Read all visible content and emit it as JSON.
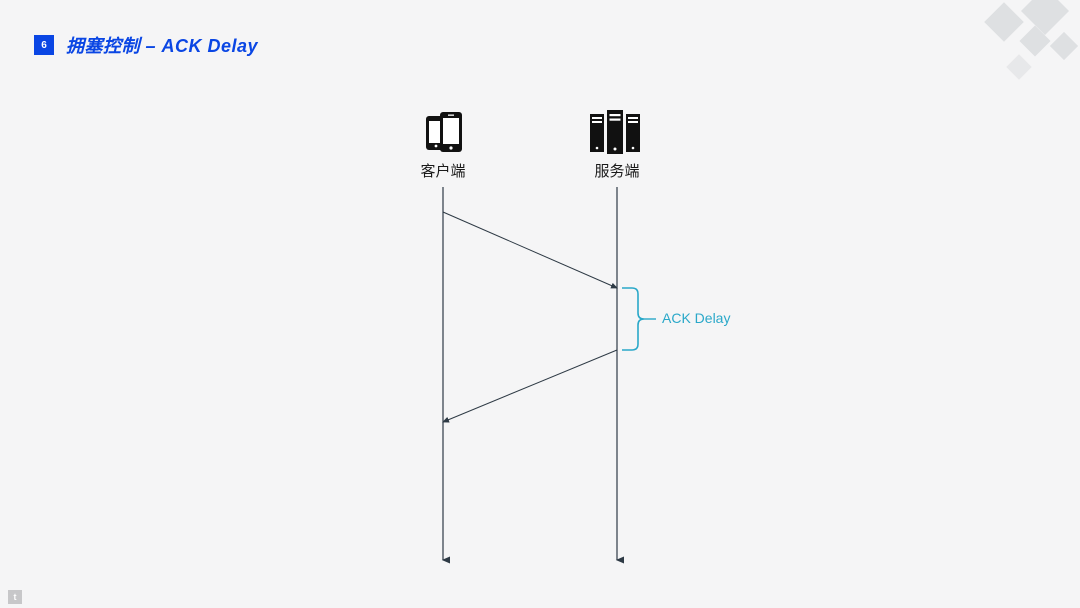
{
  "header": {
    "badge": "6",
    "title": "拥塞控制 – ACK Delay"
  },
  "labels": {
    "client": "客户端",
    "server": "服务端",
    "ack_delay": "ACK Delay"
  },
  "chart_data": {
    "type": "sequence-diagram",
    "title": "ACK Delay",
    "participants": [
      {
        "id": "client",
        "label": "客户端",
        "icon": "smartphones"
      },
      {
        "id": "server",
        "label": "服务端",
        "icon": "servers"
      }
    ],
    "events": [
      {
        "type": "message",
        "from": "client",
        "to": "server",
        "t_from": 0.08,
        "t_to": 0.28
      },
      {
        "type": "delay",
        "at": "server",
        "t_start": 0.28,
        "t_end": 0.45,
        "label": "ACK Delay"
      },
      {
        "type": "message",
        "from": "server",
        "to": "client",
        "t_from": 0.45,
        "t_to": 0.64
      }
    ],
    "timeline_range": [
      0,
      1
    ]
  }
}
